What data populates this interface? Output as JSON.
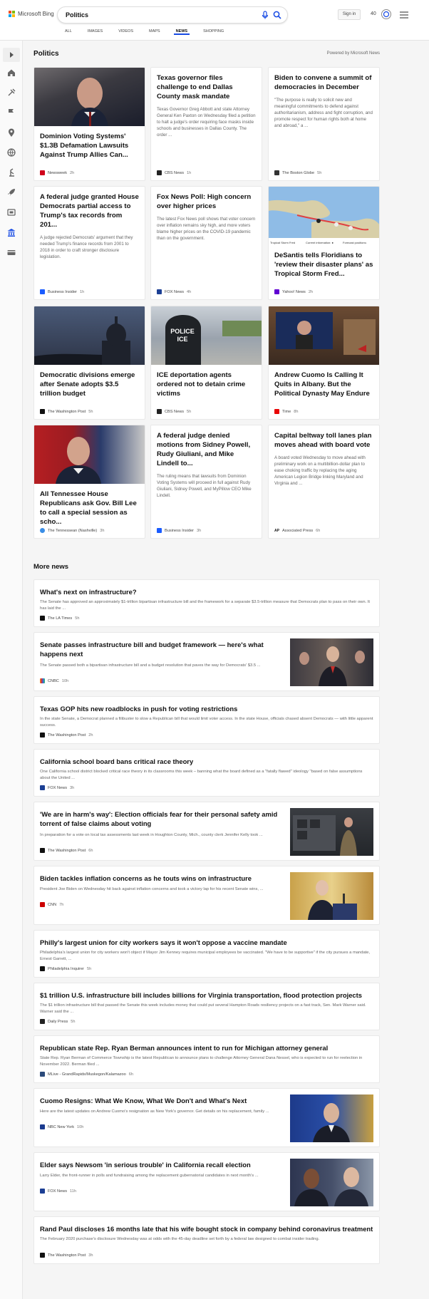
{
  "brand": {
    "name": "Microsoft Bing"
  },
  "search": {
    "query": "Politics"
  },
  "header": {
    "signin_label": "Sign in",
    "points": "40"
  },
  "tabs": [
    {
      "label": "ALL"
    },
    {
      "label": "IMAGES"
    },
    {
      "label": "VIDEOS"
    },
    {
      "label": "MAPS"
    },
    {
      "label": "NEWS"
    },
    {
      "label": "SHOPPING"
    }
  ],
  "page": {
    "title": "Politics",
    "powered_by": "Powered by Microsoft News",
    "more_news_title": "More news"
  },
  "rail_icons": [
    "expand-arrow-icon",
    "home-icon",
    "tools-icon",
    "flag-icon",
    "location-pin-icon",
    "globe-icon",
    "science-icon",
    "rocket-icon",
    "entertainment-icon",
    "politics-building-icon",
    "money-card-icon"
  ],
  "colors": {
    "accent": "#174ae4",
    "ms_red": "#f25022",
    "ms_green": "#7fba00",
    "ms_blue": "#00a4ef",
    "ms_yellow": "#ffb900"
  },
  "cards": [
    {
      "title": "Dominion Voting Systems' $1.3B Defamation Lawsuits Against Trump Allies Can...",
      "desc": "",
      "source": "Newsweek",
      "time": "2h",
      "has_image": true,
      "fav": "#d0021b"
    },
    {
      "title": "Texas governor files challenge to end Dallas County mask mandate",
      "desc": "Texas Governor Greg Abbott and state Attorney General Ken Paxton on Wednesday filed a petition to halt a judge's order requiring face masks inside schools and businesses in Dallas County. The order ...",
      "source": "CBS News",
      "time": "1h",
      "has_image": false,
      "fav": "#222"
    },
    {
      "title": "Biden to convene a summit of democracies in December",
      "desc": "\"The purpose is really to solicit new and meaningful commitments to defend against authoritarianism, address and fight corruption, and promote respect for human rights both at home and abroad,\" a ...",
      "source": "The Boston Globe",
      "time": "5h",
      "has_image": false,
      "fav": "#333"
    },
    {
      "title": "A federal judge granted House Democrats partial access to Trump's tax records from 201...",
      "desc": "A judge rejected Democrats' argument that they needed Trump's finance records from 2001 to 2018 in order to craft stronger disclosure legislation.",
      "source": "Business Insider",
      "time": "1h",
      "has_image": false,
      "fav": "#1a5cff"
    },
    {
      "title": "Fox News Poll: High concern over higher prices",
      "desc": "The latest Fox News poll shows that voter concern over inflation remains sky high, and more voters blame higher prices on the COVID-19 pandemic than on the government.",
      "source": "FOX News",
      "time": "4h",
      "has_image": false,
      "fav": "#1c3f94"
    },
    {
      "title": "DeSantis tells Floridians to 'review their disaster plans' as Tropical Storm Fred...",
      "desc": "",
      "source": "Yahoo! News",
      "time": "2h",
      "has_image": true,
      "fav": "#6001d2",
      "map_labels": [
        "Tropical Storm Fred",
        "Current information: ●",
        "Forecast positions:"
      ]
    },
    {
      "title": "Democratic divisions emerge after Senate adopts $3.5 trillion budget",
      "desc": "",
      "source": "The Washington Post",
      "time": "5h",
      "has_image": true,
      "fav": "#111"
    },
    {
      "title": "ICE deportation agents ordered not to detain crime victims",
      "desc": "",
      "source": "CBS News",
      "time": "5h",
      "has_image": true,
      "fav": "#222",
      "image_text": "POLICE ICE"
    },
    {
      "title": "Andrew Cuomo Is Calling It Quits in Albany. But the Political Dynasty May Endure",
      "desc": "",
      "source": "Time",
      "time": "8h",
      "has_image": true,
      "fav": "#e90606"
    },
    {
      "title": "All Tennessee House Republicans ask Gov. Bill Lee to call a special session as scho...",
      "desc": "",
      "source": "The Tennessean (Nashville)",
      "time": "3h",
      "has_image": true,
      "fav": "#3a8ee6"
    },
    {
      "title": "A federal judge denied motions from Sidney Powell, Rudy Giuliani, and Mike Lindell to...",
      "desc": "The ruling means that lawsuits from Dominion Voting Systems will proceed in full against Rudy Giuliani, Sidney Powell, and MyPillow CEO Mike Lindell.",
      "source": "Business Insider",
      "time": "3h",
      "has_image": false,
      "fav": "#1a5cff"
    },
    {
      "title": "Capital beltway toll lanes plan moves ahead with board vote",
      "desc": "A board voted Wednesday to move ahead with preliminary work on a multibillion-dollar plan to ease choking traffic by replacing the aging American Legion Bridge linking Maryland and Virginia and ...",
      "source": "Associated Press",
      "time": "6h",
      "has_image": false,
      "fav": "#e00",
      "fav_text": "AP"
    }
  ],
  "more_news": [
    {
      "title": "What's next on infrastructure?",
      "desc": "The Senate has approved an approximately $1-trillion bipartisan infrastructure bill and the framework for a separate $3.5-trillion measure that Democrats plan to pass on their own. It has laid the ...",
      "source": "The LA Times",
      "time": "5h",
      "thumb": false,
      "fav": "#111"
    },
    {
      "title": "Senate passes infrastructure bill and budget framework — here's what happens next",
      "desc": "The Senate passed both a bipartisan infrastructure bill and a budget resolution that paves the way for Democrats' $3.5 ...",
      "source": "CNBC",
      "time": "10h",
      "thumb": true,
      "fav": "#f4a51c"
    },
    {
      "title": "Texas GOP hits new roadblocks in push for voting restrictions",
      "desc": "In the state Senate, a Democrat planned a filibuster to slow a Republican bill that would limit voter access. In the state House, officials chased absent Democrats — with little apparent success.",
      "source": "The Washington Post",
      "time": "2h",
      "thumb": false,
      "fav": "#111"
    },
    {
      "title": "California school board bans critical race theory",
      "desc": "One California school district blocked critical race theory in its classrooms this week – banning what the board defined as a \"fatally flawed\" ideology \"based on false assumptions about the United ...",
      "source": "FOX News",
      "time": "3h",
      "thumb": false,
      "fav": "#1c3f94"
    },
    {
      "title": "'We are in harm's way': Election officials fear for their personal safety amid torrent of false claims about voting",
      "desc": "In preparation for a vote on local tax assessments last week in Houghton County, Mich., county clerk Jennifer Kelly took ...",
      "source": "The Washington Post",
      "time": "6h",
      "thumb": true,
      "fav": "#111"
    },
    {
      "title": "Biden tackles inflation concerns as he touts wins on infrastructure",
      "desc": "President Joe Biden on Wednesday hit back against inflation concerns and took a victory lap for his recent Senate wins, ...",
      "source": "CNN",
      "time": "7h",
      "thumb": true,
      "fav": "#cc0000"
    },
    {
      "title": "Philly's largest union for city workers says it won't oppose a vaccine mandate",
      "desc": "Philadelphia's largest union for city workers won't object if Mayor Jim Kenney requires municipal employees be vaccinated. \"We have to be supportive\" if the city pursues a mandate, Ernest Garrett, ...",
      "source": "Philadelphia Inquirer",
      "time": "5h",
      "thumb": false,
      "fav": "#111"
    },
    {
      "title": "$1 trillion U.S. infrastructure bill includes billions for Virginia transportation, flood protection projects",
      "desc": "The $1 trillion infrastructure bill that passed the Senate this week includes money that could put several Hampton Roads resiliency projects on a fast track, Sen. Mark Warner said. Warner said the ...",
      "source": "Daily Press",
      "time": "5h",
      "thumb": false,
      "fav": "#222"
    },
    {
      "title": "Republican state Rep. Ryan Berman announces intent to run for Michigan attorney general",
      "desc": "State Rep. Ryan Berman of Commerce Township is the latest Republican to announce plans to challenge Attorney General Dana Nessel, who is expected to run for reelection in November 2022. Berman filed ...",
      "source": "MLive - GrandRapids/Muskegon/Kalamazoo",
      "time": "6h",
      "thumb": false,
      "fav": "#2b4a7a"
    },
    {
      "title": "Cuomo Resigns: What We Know, What We Don't and What's Next",
      "desc": "Here are the latest updates on Andrew Cuomo's resignation as New York's governor. Get details on his replacement, family ...",
      "source": "NBC New York",
      "time": "10h",
      "thumb": true,
      "fav": "#1b3b8f"
    },
    {
      "title": "Elder says Newsom 'in serious trouble' in California recall election",
      "desc": "Larry Elder, the front-runner in polls and fundraising among the replacement gubernatorial candidates in next month's ...",
      "source": "FOX News",
      "time": "11h",
      "thumb": true,
      "fav": "#1c3f94"
    },
    {
      "title": "Rand Paul discloses 16 months late that his wife bought stock in company behind coronavirus treatment",
      "desc": "The February 2020 purchase's disclosure Wednesday was at odds with the 45-day deadline set forth by a federal law designed to combat insider trading.",
      "source": "The Washington Post",
      "time": "3h",
      "thumb": false,
      "fav": "#111"
    }
  ]
}
